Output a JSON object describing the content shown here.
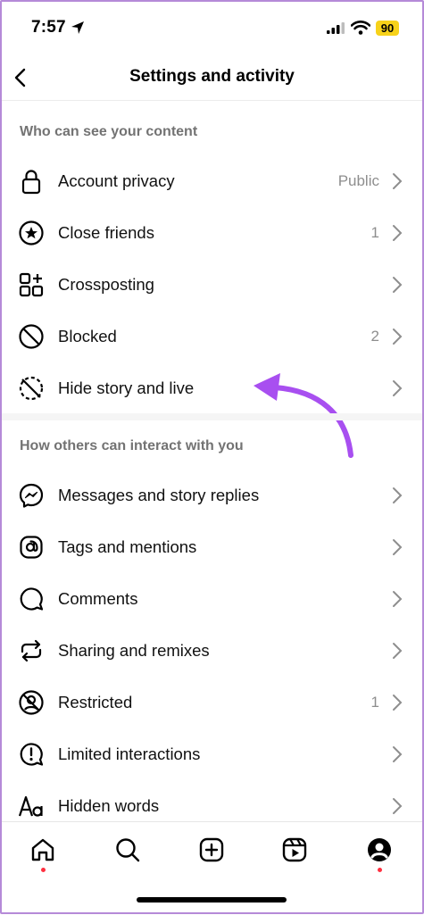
{
  "status_bar": {
    "time": "7:57",
    "battery": "90"
  },
  "header": {
    "title": "Settings and activity"
  },
  "sections": [
    {
      "title": "Who can see your content",
      "items": [
        {
          "label": "Account privacy",
          "value": "Public",
          "icon": "lock-icon"
        },
        {
          "label": "Close friends",
          "value": "1",
          "icon": "star-circle-icon"
        },
        {
          "label": "Crossposting",
          "value": "",
          "icon": "grid-plus-icon"
        },
        {
          "label": "Blocked",
          "value": "2",
          "icon": "blocked-icon"
        },
        {
          "label": "Hide story and live",
          "value": "",
          "icon": "hide-story-icon"
        }
      ]
    },
    {
      "title": "How others can interact with you",
      "items": [
        {
          "label": "Messages and story replies",
          "value": "",
          "icon": "messenger-icon"
        },
        {
          "label": "Tags and mentions",
          "value": "",
          "icon": "at-sign-icon"
        },
        {
          "label": "Comments",
          "value": "",
          "icon": "comment-icon"
        },
        {
          "label": "Sharing and remixes",
          "value": "",
          "icon": "repost-icon"
        },
        {
          "label": "Restricted",
          "value": "1",
          "icon": "restricted-icon"
        },
        {
          "label": "Limited interactions",
          "value": "",
          "icon": "alert-bubble-icon"
        },
        {
          "label": "Hidden words",
          "value": "",
          "icon": "text-aa-icon"
        }
      ]
    }
  ],
  "tab_bar": [
    "home-icon",
    "search-icon",
    "create-icon",
    "reels-icon",
    "profile-icon"
  ],
  "colors": {
    "annotation_arrow": "#a84ff0",
    "notification_dot": "#ff3040",
    "battery": "#f7d21a"
  }
}
